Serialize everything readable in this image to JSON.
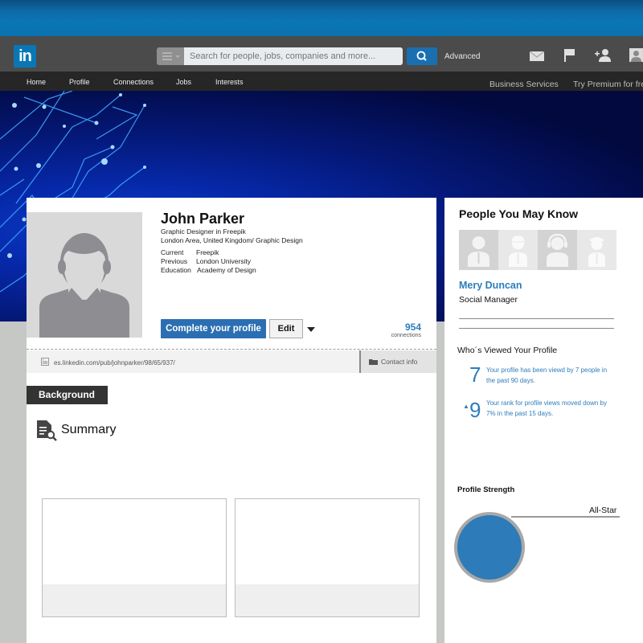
{
  "header": {
    "logo_text": "in",
    "search": {
      "placeholder": "Search for people, jobs, companies and more...",
      "value": ""
    },
    "advanced_label": "Advanced",
    "icons": [
      "messages-icon",
      "notifications-flag-icon",
      "add-connection-icon",
      "account-avatar-icon"
    ]
  },
  "nav": {
    "items": [
      {
        "label": "Home"
      },
      {
        "label": "Profile"
      },
      {
        "label": "Connections"
      },
      {
        "label": "Jobs"
      },
      {
        "label": "Interests"
      }
    ],
    "right_links": [
      {
        "label": "Business Services"
      },
      {
        "label": "Try Premium for free"
      }
    ]
  },
  "profile": {
    "name": "John Parker",
    "headline": "Graphic Designer in Freepik",
    "location": "London Area, United Kingdom/ Graphic Design",
    "details": [
      {
        "label": "Current",
        "value": "Freepik"
      },
      {
        "label": "Previous",
        "value": "London University"
      },
      {
        "label": "Education",
        "value": "Academy of Design"
      }
    ],
    "complete_button": "Complete your profile",
    "edit_button": "Edit",
    "connections_count": "954",
    "connections_label": "connections",
    "public_url": "es.linkedin.com/pub/johnparker/98/65/937/",
    "contact_info_label": "Contact info",
    "background_tab": "Background",
    "summary_title": "Summary"
  },
  "sidebar": {
    "pymk_title": "People You May Know",
    "pymk_person": {
      "name": "Mery Duncan",
      "role": "Social Manager"
    },
    "wvp_title": "Who´s Viewed Your Profile",
    "stats": [
      {
        "number": "7",
        "text": "Your profile has been viewd by 7 people in the past 90 days."
      },
      {
        "prefix": "▲",
        "number": "9",
        "text": "Your rank for profile views moved down by 7% in the past 15 days."
      }
    ],
    "profile_strength_title": "Profile Strength",
    "profile_strength_level": "All-Star"
  },
  "colors": {
    "brand_blue": "#0a77b5",
    "link_blue": "#2d7dbd",
    "button_blue": "#2b6fb2",
    "header_grey": "#4b4b4b",
    "nav_dark": "#262626"
  }
}
